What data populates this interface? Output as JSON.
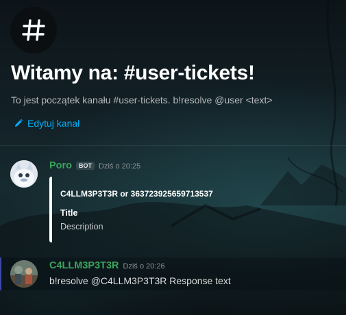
{
  "channel": {
    "icon": "hashtag-icon",
    "welcome_title": "Witamy na: #user-tickets!",
    "welcome_subtitle": "To jest początek kanału #user-tickets. b!resolve @user <text>",
    "edit_label": "Edytuj kanał",
    "edit_icon": "pencil-icon",
    "accent": "#00aff4"
  },
  "messages": [
    {
      "author": "Poro",
      "bot_tag": "BOT",
      "timestamp": "Dziś o 20:25",
      "avatar": "poro-avatar",
      "name_color": "#3ba55c",
      "embed": {
        "author": "C4LLM3P3T3R or 363723925659713537",
        "title": "Title",
        "description": "Description",
        "color": "#ffffff"
      }
    },
    {
      "author": "C4LLM3P3T3R",
      "timestamp": "Dziś o 20:26",
      "avatar": "user-avatar",
      "name_color": "#3ba55c",
      "text": "b!resolve @C4LLM3P3T3R Response text"
    }
  ]
}
